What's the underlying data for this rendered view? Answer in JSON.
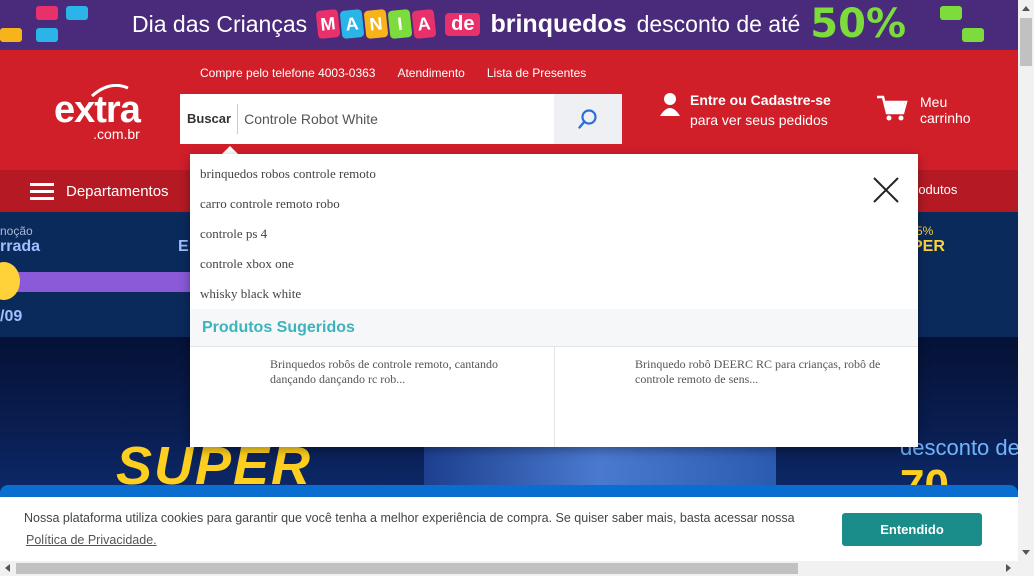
{
  "promo": {
    "text_before": "Dia das Crianças",
    "mania_letters": [
      "M",
      "A",
      "N",
      "I",
      "A"
    ],
    "mania_colors": [
      "#e8306a",
      "#2ab4e8",
      "#f6b31a",
      "#7bdc3c",
      "#e8306a"
    ],
    "de": "de",
    "brinquedos": "brinquedos",
    "desconto": "desconto de até",
    "percent": "50%"
  },
  "header": {
    "logo_main": "extra",
    "logo_sub": ".com.br",
    "top_links": [
      "Compre pelo telefone 4003-0363",
      "Atendimento",
      "Lista de Presentes"
    ],
    "search": {
      "label": "Buscar",
      "value": "Controle Robot White",
      "button_icon": "search-icon"
    },
    "account": {
      "title": "Entre ou Cadastre-se",
      "subtitle": "para ver seus pedidos",
      "icon": "user-icon"
    },
    "cart": {
      "line1": "Meu",
      "line2": "carrinho",
      "icon": "cart-icon"
    }
  },
  "nav": {
    "departments_label": "Departamentos",
    "right_fragment": "rodutos"
  },
  "strip": {
    "left_small": "noção",
    "left_big": "rrada",
    "middle_fragment": "E",
    "right_small": "5%",
    "right_big": "PER",
    "date_fragment": "/09"
  },
  "hero": {
    "super": "SUPER",
    "desconto": "desconto de",
    "big_number": "70"
  },
  "autocomplete": {
    "suggestions": [
      "brinquedos robos controle remoto",
      "carro controle remoto robo",
      "controle ps 4",
      "controle xbox one",
      "whisky black white"
    ],
    "products_header": "Produtos Sugeridos",
    "products": [
      {
        "name": "Brinquedos robôs de controle remoto, cantando dançando dançando rc rob..."
      },
      {
        "name": "Brinquedo robô DEERC RC para crianças, robô de controle remoto de sens..."
      }
    ]
  },
  "cookie": {
    "text": "Nossa plataforma utiliza cookies para garantir que você tenha a melhor experiência de compra. Se quiser saber mais, basta acessar nossa",
    "link": "Política de Privacidade.",
    "button": "Entendido"
  },
  "colors": {
    "header_red": "#d11f2a",
    "nav_red": "#b51a24",
    "accent_teal": "#3db3bd",
    "cookie_button": "#1a8c8a"
  }
}
